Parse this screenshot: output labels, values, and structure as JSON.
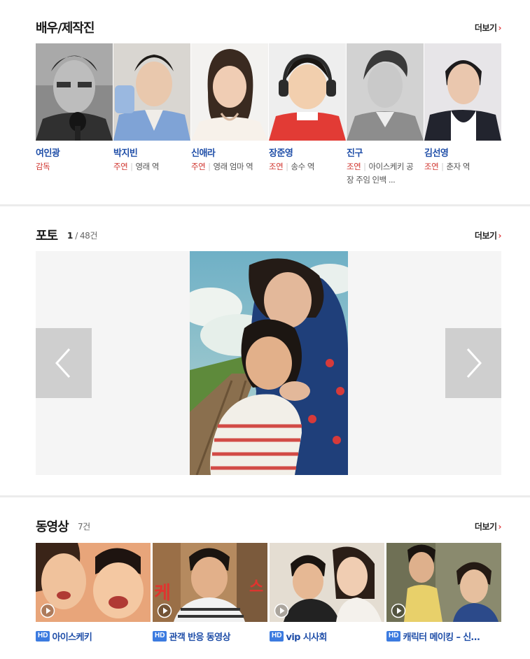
{
  "cast_section": {
    "title": "배우/제작진",
    "more_label": "더보기",
    "members": [
      {
        "name": "여인광",
        "role_type": "감독",
        "role": ""
      },
      {
        "name": "박지빈",
        "role_type": "주연",
        "role": "영래 역"
      },
      {
        "name": "신애라",
        "role_type": "주연",
        "role": "영래 엄마 역"
      },
      {
        "name": "장준영",
        "role_type": "조연",
        "role": "송수 역"
      },
      {
        "name": "진구",
        "role_type": "조연",
        "role": "아이스케키 공장 주임 인백 ..."
      },
      {
        "name": "김선영",
        "role_type": "조연",
        "role": "춘자 역"
      }
    ]
  },
  "photo_section": {
    "title": "포토",
    "current": "1",
    "total": "/ 48건",
    "more_label": "더보기"
  },
  "video_section": {
    "title": "동영상",
    "count": "7건",
    "more_label": "더보기",
    "badge": "HD",
    "videos": [
      {
        "title": "아이스케키"
      },
      {
        "title": "관객 반응 동영상"
      },
      {
        "title": "vip 시사회"
      },
      {
        "title": "캐릭터 메이킹 – 신…"
      }
    ]
  },
  "icons": {
    "prev": "chevron-left-icon",
    "next": "chevron-right-icon",
    "play": "play-circle-icon",
    "more": "chevron-right-icon"
  },
  "colors": {
    "name_link": "#1f4ea8",
    "role_type": "#d0362f",
    "more_chevron": "#e03a3e",
    "hd_badge": "#3c7be0",
    "divider": "#ececec"
  }
}
